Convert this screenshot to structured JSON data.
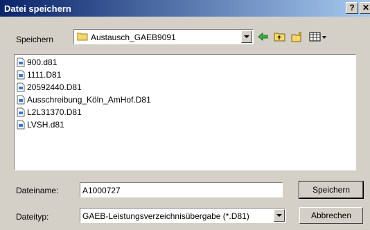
{
  "window": {
    "title": "Datei speichern",
    "help_label": "?",
    "close_label": "✕"
  },
  "toolbar": {
    "save_in_label": "Speichern",
    "folder_value": "Austausch_GAEB9091",
    "icons": [
      "back-icon",
      "up-folder-icon",
      "new-folder-icon",
      "view-menu-icon"
    ]
  },
  "files": [
    {
      "name": "900.d81"
    },
    {
      "name": "1111.D81"
    },
    {
      "name": "20592440.D81"
    },
    {
      "name": "Ausschreibung_Köln_AmHof.D81"
    },
    {
      "name": "L2L31370.D81"
    },
    {
      "name": "LVSH.d81"
    }
  ],
  "filename": {
    "label": "Dateiname:",
    "value": "A1000727"
  },
  "filetype": {
    "label": "Dateityp:",
    "value": "GAEB-Leistungsverzeichnisübergabe (*.D81)"
  },
  "buttons": {
    "save": "Speichern",
    "cancel": "Abbrechen"
  },
  "colors": {
    "title_start": "#0a246a",
    "title_end": "#a6caf0",
    "face": "#d4d0c8"
  }
}
